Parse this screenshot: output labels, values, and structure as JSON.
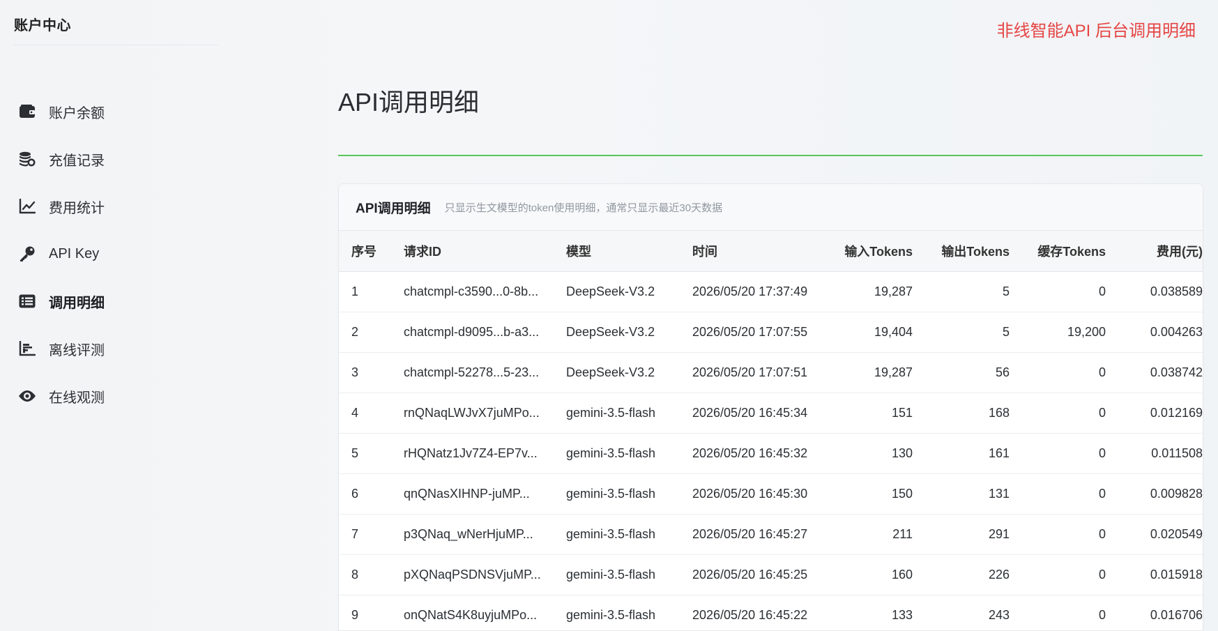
{
  "sidebar": {
    "title": "账户中心",
    "items": [
      {
        "label": "账户余额",
        "icon": "wallet-icon",
        "active": false
      },
      {
        "label": "充值记录",
        "icon": "coins-icon",
        "active": false
      },
      {
        "label": "费用统计",
        "icon": "line-chart-icon",
        "active": false
      },
      {
        "label": "API Key",
        "icon": "key-icon",
        "active": false
      },
      {
        "label": "调用明细",
        "icon": "list-icon",
        "active": true
      },
      {
        "label": "离线评测",
        "icon": "bar-chart-icon",
        "active": false
      },
      {
        "label": "在线观测",
        "icon": "eye-icon",
        "active": false
      }
    ]
  },
  "banner": "非线智能API 后台调用明细",
  "page": {
    "title": "API调用明细"
  },
  "card": {
    "title": "API调用明细",
    "subtitle": "只显示生文模型的token使用明细，通常只显示最近30天数据"
  },
  "colors": {
    "accent_rule": "#5ac55a",
    "banner": "#e64545"
  },
  "table": {
    "columns": [
      "序号",
      "请求ID",
      "模型",
      "时间",
      "输入Tokens",
      "输出Tokens",
      "缓存Tokens",
      "费用(元)"
    ],
    "rows": [
      [
        "1",
        "chatcmpl-c3590...0-8b...",
        "DeepSeek-V3.2",
        "2026/05/20 17:37:49",
        "19,287",
        "5",
        "0",
        "0.038589"
      ],
      [
        "2",
        "chatcmpl-d9095...b-a3...",
        "DeepSeek-V3.2",
        "2026/05/20 17:07:55",
        "19,404",
        "5",
        "19,200",
        "0.004263"
      ],
      [
        "3",
        "chatcmpl-52278...5-23...",
        "DeepSeek-V3.2",
        "2026/05/20 17:07:51",
        "19,287",
        "56",
        "0",
        "0.038742"
      ],
      [
        "4",
        "rnQNaqLWJvX7juMPo...",
        "gemini-3.5-flash",
        "2026/05/20 16:45:34",
        "151",
        "168",
        "0",
        "0.012169"
      ],
      [
        "5",
        "rHQNatz1Jv7Z4-EP7v...",
        "gemini-3.5-flash",
        "2026/05/20 16:45:32",
        "130",
        "161",
        "0",
        "0.011508"
      ],
      [
        "6",
        "qnQNasXIHNP-juMP...",
        "gemini-3.5-flash",
        "2026/05/20 16:45:30",
        "150",
        "131",
        "0",
        "0.009828"
      ],
      [
        "7",
        "p3QNaq_wNerHjuMP...",
        "gemini-3.5-flash",
        "2026/05/20 16:45:27",
        "211",
        "291",
        "0",
        "0.020549"
      ],
      [
        "8",
        "pXQNaqPSDNSVjuMP...",
        "gemini-3.5-flash",
        "2026/05/20 16:45:25",
        "160",
        "226",
        "0",
        "0.015918"
      ],
      [
        "9",
        "onQNatS4K8uyjuMPo...",
        "gemini-3.5-flash",
        "2026/05/20 16:45:22",
        "133",
        "243",
        "0",
        "0.016706"
      ]
    ]
  }
}
